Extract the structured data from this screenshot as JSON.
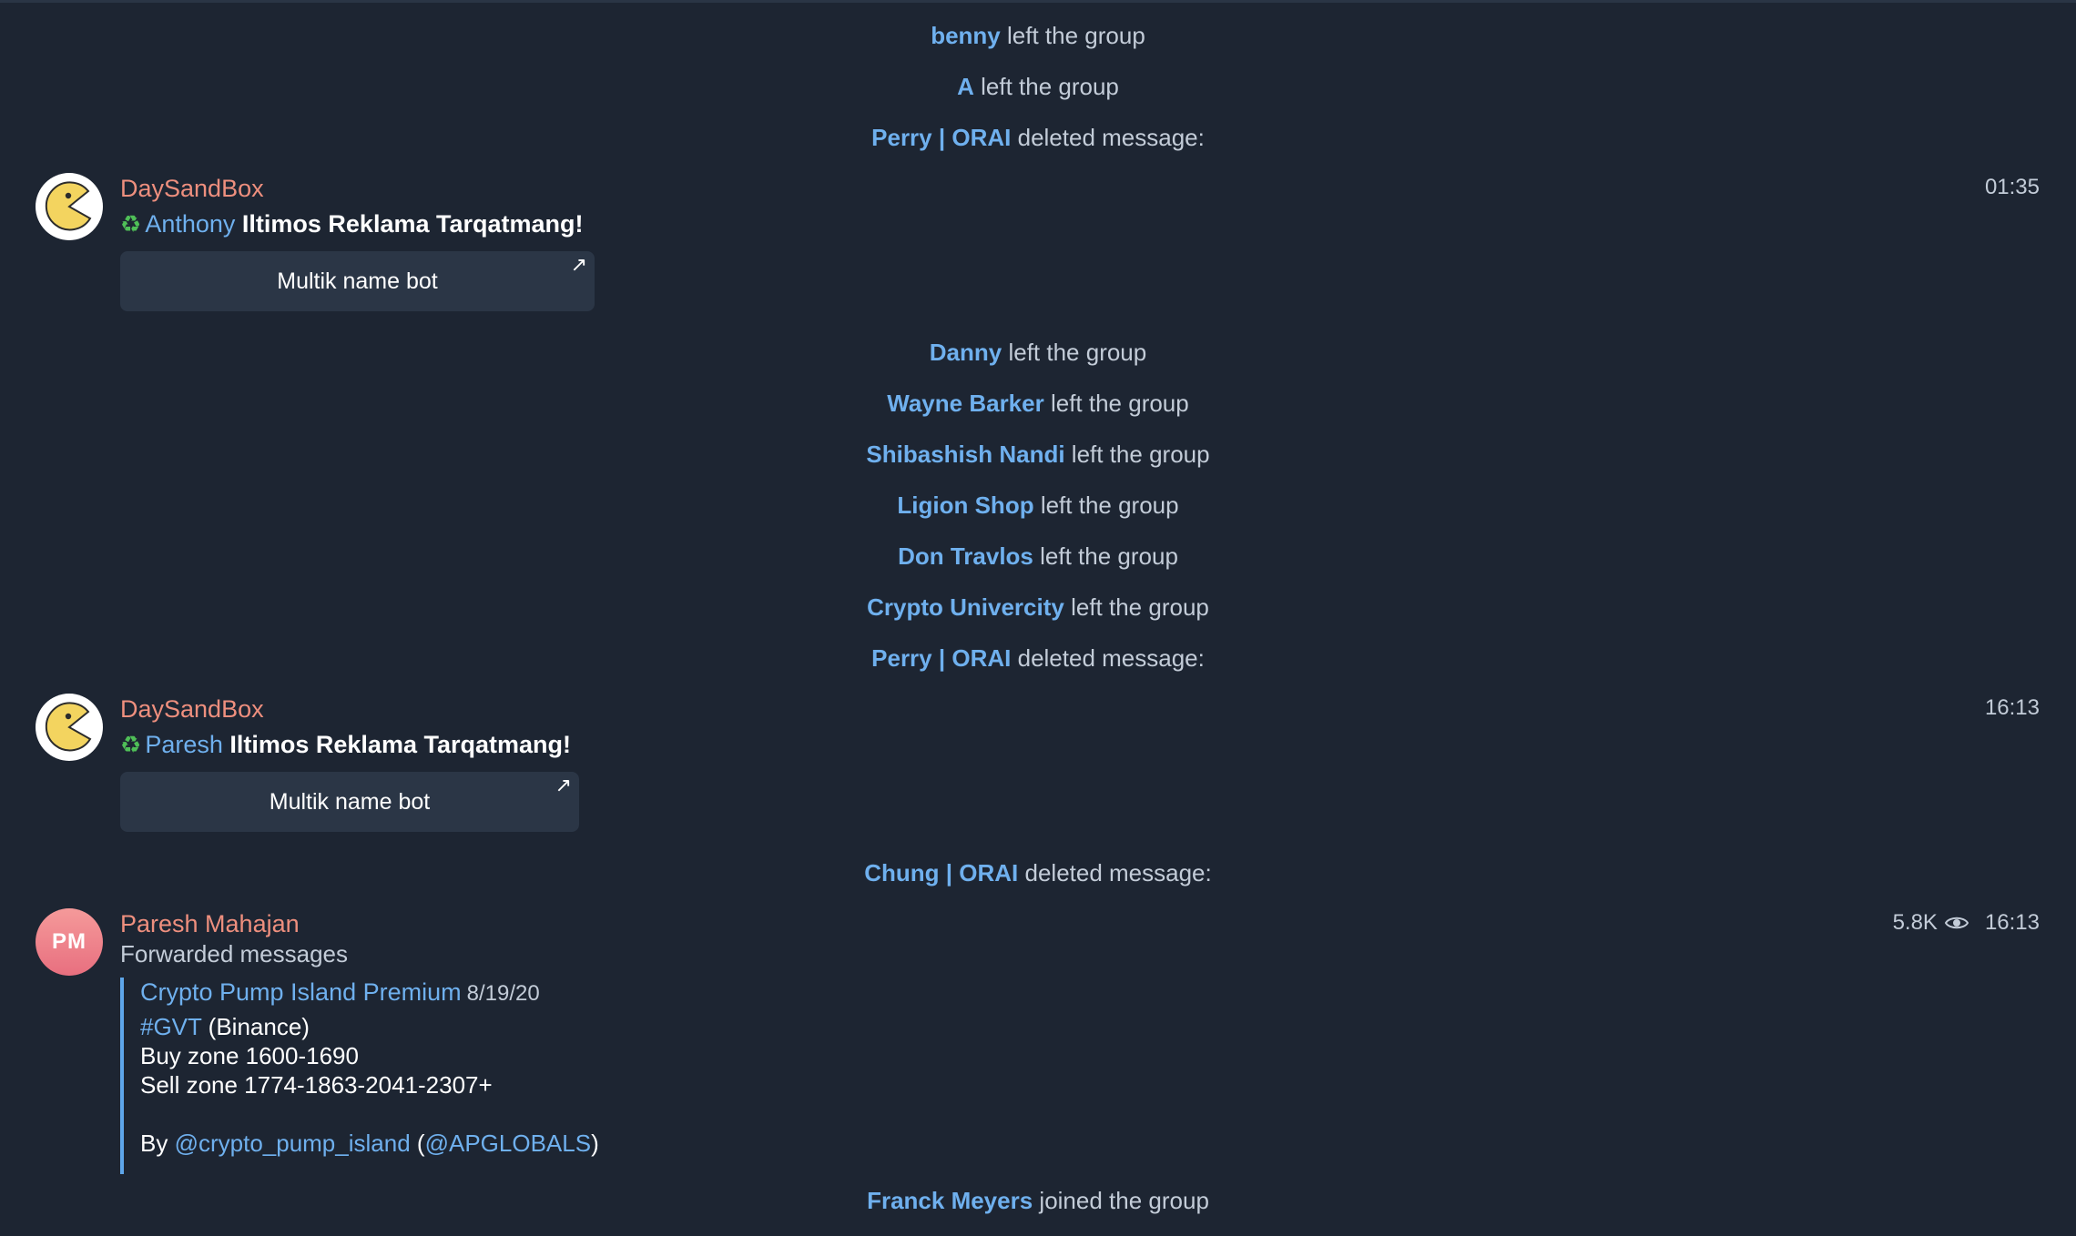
{
  "service_messages": [
    {
      "name": "benny",
      "action": "left the group"
    },
    {
      "name": "A",
      "action": "left the group"
    },
    {
      "name": "Perry | ORAI",
      "action": "deleted message:"
    },
    {
      "name": "Danny",
      "action": "left the group"
    },
    {
      "name": "Wayne Barker",
      "action": "left the group"
    },
    {
      "name": "Shibashish Nandi",
      "action": "left the group"
    },
    {
      "name": "Ligion Shop",
      "action": "left the group"
    },
    {
      "name": "Don Travlos",
      "action": "left the group"
    },
    {
      "name": "Crypto Univercity",
      "action": "left the group"
    },
    {
      "name": "Perry | ORAI",
      "action": "deleted message:"
    },
    {
      "name": "Chung | ORAI",
      "action": "deleted message:"
    },
    {
      "name": "Franck Meyers",
      "action": "joined the group"
    }
  ],
  "messages": [
    {
      "sender": "DaySandBox",
      "time": "01:35",
      "icon": "recycle-icon",
      "mention": "Anthony",
      "text": "Iltimos Reklama Tarqatmang!",
      "button": "Multik name bot"
    },
    {
      "sender": "DaySandBox",
      "time": "16:13",
      "icon": "recycle-icon",
      "mention": "Paresh",
      "text": "Iltimos Reklama Tarqatmang!",
      "button": "Multik name bot"
    }
  ],
  "forwarded": {
    "sender": "Paresh Mahajan",
    "initials": "PM",
    "views": "5.8K",
    "time": "16:13",
    "label": "Forwarded messages",
    "channel": "Crypto Pump Island Premium",
    "date": "8/19/20",
    "hashtag": "#GVT",
    "exchange": "(Binance)",
    "buy": "Buy zone 1600-1690",
    "sell": "Sell zone 1774-1863-2041-2307+",
    "by_prefix": "By",
    "link1": "@crypto_pump_island",
    "link2": "@APGLOBALS",
    "paren_open": "(",
    "paren_close": ")"
  },
  "colors": {
    "background": "#1d2532",
    "accent": "#6fb0ee",
    "sender": "#ee8f7e"
  }
}
